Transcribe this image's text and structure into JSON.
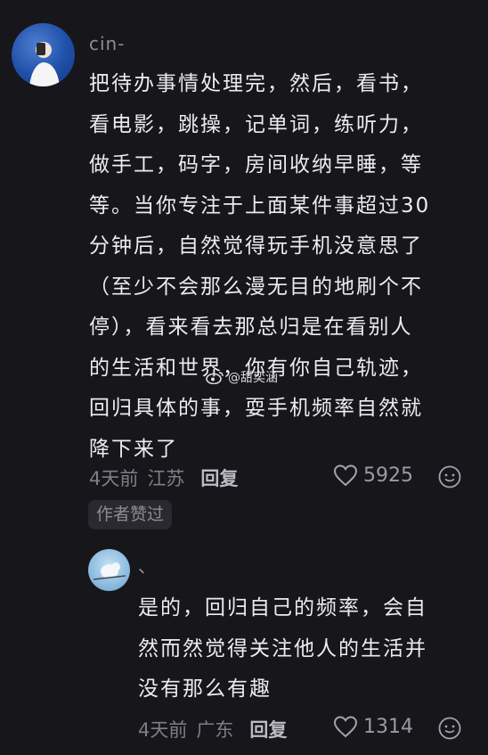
{
  "main_comment": {
    "username": "cin-",
    "text": "把待办事情处理完，然后，看书，\n看电影，跳操，记单词，练听力，\n做手工，码字，房间收纳早睡，等\n等。当你专注于上面某件事超过30\n分钟后，自然觉得玩手机没意思了\n（至少不会那么漫无目的地刷个不\n停），看来看去那总归是在看别人\n的生活和世界，你有你自己轨迹，\n回归具体的事，耍手机频率自然就\n降下来了",
    "time": "4天前",
    "location": "江苏",
    "reply_label": "回复",
    "likes": "5925",
    "badge": "作者赞过"
  },
  "reply_comment": {
    "username": "、",
    "text": "是的，回归自己的频率，会自\n然而然觉得关注他人的生活并\n没有那么有趣",
    "time": "4天前",
    "location": "广东",
    "reply_label": "回复",
    "likes": "1314"
  },
  "watermark": {
    "text": "@甜奕涵"
  },
  "colors": {
    "background": "#17161b",
    "text": "#ececef",
    "muted": "#7f7e86"
  },
  "icons": [
    "heart-icon",
    "emoji-icon",
    "weibo-logo-icon"
  ]
}
